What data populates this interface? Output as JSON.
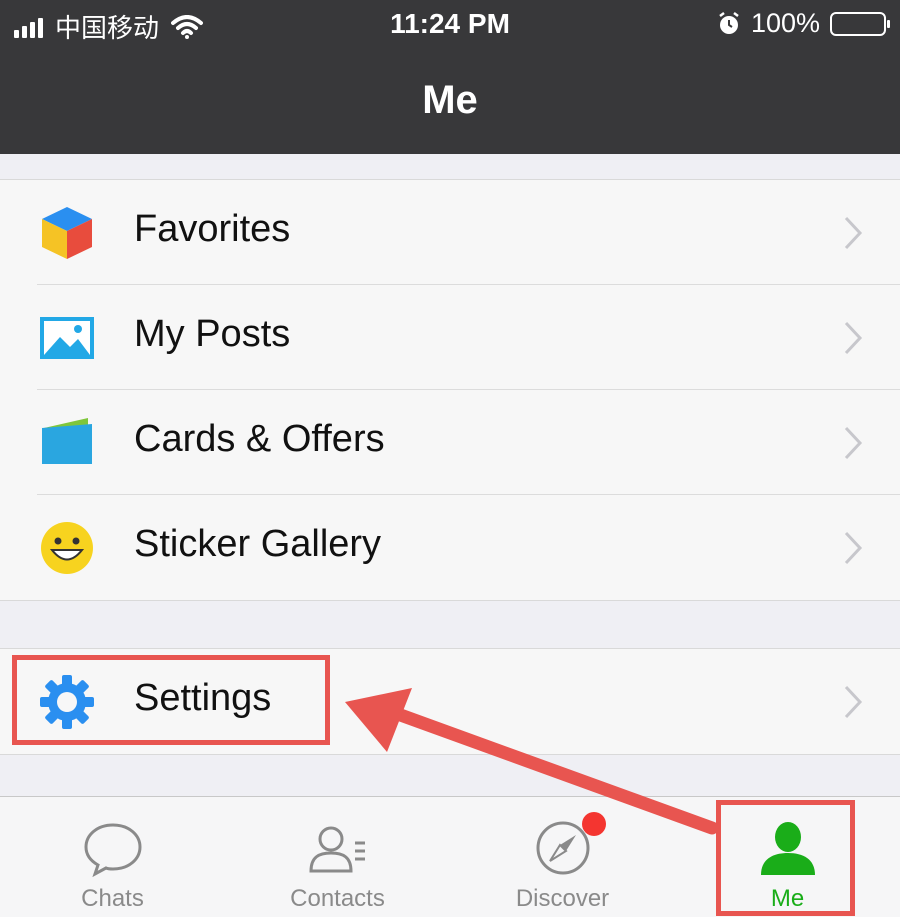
{
  "status_bar": {
    "carrier": "中国移动",
    "time": "11:24 PM",
    "battery": "100%",
    "icons": [
      "signal-icon",
      "wifi-icon",
      "alarm-icon",
      "battery-icon"
    ]
  },
  "nav": {
    "title": "Me"
  },
  "menu_group_1": [
    {
      "label": "Favorites",
      "icon": "cube-icon"
    },
    {
      "label": "My Posts",
      "icon": "photo-icon"
    },
    {
      "label": "Cards & Offers",
      "icon": "wallet-icon"
    },
    {
      "label": "Sticker Gallery",
      "icon": "smiley-icon"
    }
  ],
  "menu_group_2": [
    {
      "label": "Settings",
      "icon": "gear-icon"
    }
  ],
  "tab_bar": {
    "tabs": [
      {
        "label": "Chats",
        "icon": "chat-bubble-icon"
      },
      {
        "label": "Contacts",
        "icon": "contacts-icon"
      },
      {
        "label": "Discover",
        "icon": "compass-icon"
      },
      {
        "label": "Me",
        "icon": "person-icon"
      }
    ],
    "active": "Me"
  },
  "colors": {
    "nav_background": "#38383a",
    "active_tab": "#1aad19",
    "annotation": "#e85550",
    "badge": "#f43530"
  }
}
